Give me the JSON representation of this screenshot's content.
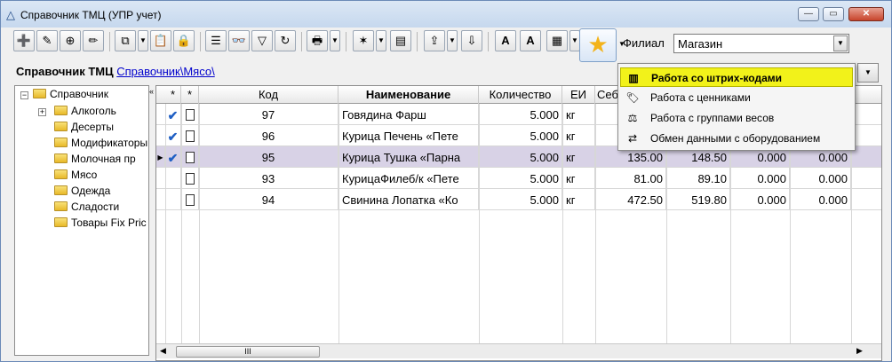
{
  "window": {
    "title": "Справочник ТМЦ (УПР учет)",
    "buttons": {
      "minimize": "—",
      "maximize": "▭",
      "close": "✕"
    }
  },
  "toolbar": {
    "icons": [
      "add-icon",
      "edit-icon",
      "add-child-icon",
      "pencil-icon",
      "copy-icon",
      "paste-icon",
      "lock-icon",
      "list-icon",
      "binoculars-icon",
      "filter-icon",
      "refresh-icon",
      "printer-icon",
      "wand-icon",
      "report-icon",
      "export-icon",
      "import-icon",
      "font-a-icon",
      "font-a-outline-icon",
      "form-icon",
      "star-icon"
    ]
  },
  "filial": {
    "label": "Филиал",
    "value": "Магазин"
  },
  "breadcrumb": {
    "title": "Справочник ТМЦ",
    "path": "Справочник\\Мясо\\"
  },
  "tree": {
    "root": "Справочник",
    "items": [
      "Алкоголь",
      "Десерты",
      "Модификаторы",
      "Молочная пр",
      "Мясо",
      "Одежда",
      "Сладости",
      "Товары Fix Pric"
    ]
  },
  "grid": {
    "columns": [
      "*",
      "*",
      "Код",
      "Наименование",
      "Количество",
      "ЕИ",
      "Себ"
    ],
    "rows": [
      {
        "checked": true,
        "code": "97",
        "name": "Говядина Фарш",
        "qty": "5.000",
        "unit": "кг",
        "c1": "",
        "c2": "",
        "c3": "",
        "c4": "",
        "selected": false
      },
      {
        "checked": true,
        "code": "96",
        "name": "Курица Печень  «Пете",
        "qty": "5.000",
        "unit": "кг",
        "c1": "",
        "c2": "",
        "c3": "",
        "c4": "",
        "selected": false
      },
      {
        "checked": true,
        "code": "95",
        "name": "Курица Тушка  «Парна",
        "qty": "5.000",
        "unit": "кг",
        "c1": "135.00",
        "c2": "148.50",
        "c3": "0.000",
        "c4": "0.000",
        "selected": true
      },
      {
        "checked": false,
        "code": "93",
        "name": "КурицаФилеб/к «Пете",
        "qty": "5.000",
        "unit": "кг",
        "c1": "81.00",
        "c2": "89.10",
        "c3": "0.000",
        "c4": "0.000",
        "selected": false
      },
      {
        "checked": false,
        "code": "94",
        "name": "Свинина Лопатка  «Ко",
        "qty": "5.000",
        "unit": "кг",
        "c1": "472.50",
        "c2": "519.80",
        "c3": "0.000",
        "c4": "0.000",
        "selected": false
      }
    ],
    "scroll_thumb": "III"
  },
  "menu": {
    "items": [
      {
        "label": "Работа со штрих-кодами",
        "icon": "barcode-icon"
      },
      {
        "label": "Работа с ценниками",
        "icon": "price-tag-icon"
      },
      {
        "label": "Работа с группами весов",
        "icon": "scales-icon"
      },
      {
        "label": "Обмен данными с оборудованием",
        "icon": "equipment-exchange-icon"
      }
    ]
  }
}
